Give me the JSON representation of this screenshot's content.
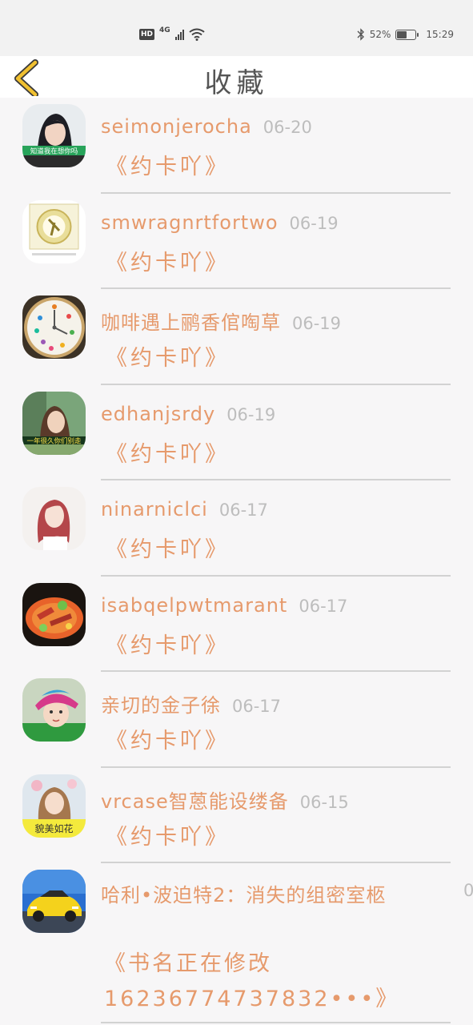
{
  "status_bar": {
    "hd": "HD",
    "network": "4G",
    "battery_text": "52%",
    "battery_level": 0.52,
    "time": "15:29"
  },
  "header": {
    "title": "收藏",
    "back_icon": "chevron-left-icon"
  },
  "items": [
    {
      "name": "seimonjerocha",
      "date": "06-20",
      "book": "《约卡吖》",
      "avatar_caption": "知道我在想你吗"
    },
    {
      "name": "smwragnrtfortwo",
      "date": "06-19",
      "book": "《约卡吖》"
    },
    {
      "name": "咖啡遇上鹂香倌啕草",
      "date": "06-19",
      "book": "《约卡吖》"
    },
    {
      "name": "edhanjsrdy",
      "date": "06-19",
      "book": "《约卡吖》",
      "avatar_caption": "一年很久你们别走"
    },
    {
      "name": "ninarniclci",
      "date": "06-17",
      "book": "《约卡吖》"
    },
    {
      "name": "isabqelpwtmarant",
      "date": "06-17",
      "book": "《约卡吖》"
    },
    {
      "name": "亲切的金子徐",
      "date": "06-17",
      "book": "《约卡吖》"
    },
    {
      "name": "vrcase智蒽能设缕备",
      "date": "06-15",
      "book": "《约卡吖》",
      "avatar_caption": "貌美如花"
    },
    {
      "name": "哈利•波迫特2：消失的组密室柩",
      "date": "0",
      "book": "《书名正在修改16236774737832•••》"
    }
  ],
  "colors": {
    "accent": "#e69a6c",
    "date": "#bdbdbd",
    "back_icon": "#f0c030",
    "divider": "#d2d2d2"
  }
}
